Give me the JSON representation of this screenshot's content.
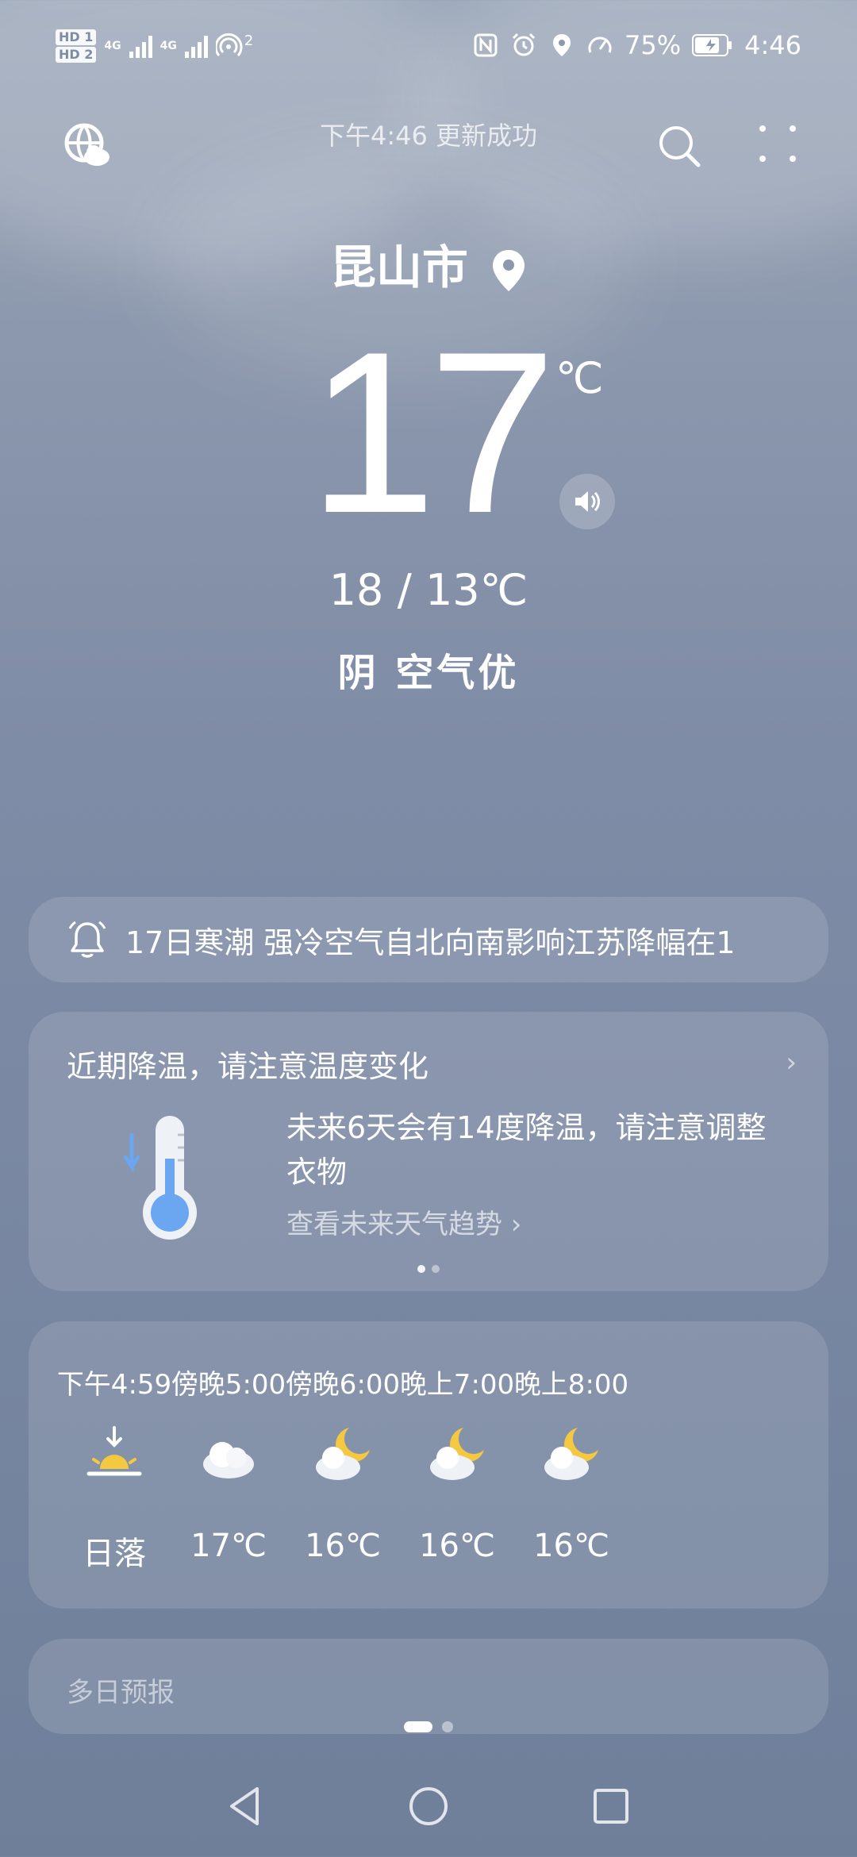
{
  "status_bar": {
    "hd1": "HD 1",
    "hd2": "HD 2",
    "net1": "4G",
    "net2": "4G",
    "hotspot_count": "2",
    "battery": "75%",
    "time": "4:46"
  },
  "header": {
    "update_status": "下午4:46 更新成功"
  },
  "location": {
    "city": "昆山市"
  },
  "current": {
    "temperature": "17",
    "unit": "℃",
    "range": "18 / 13℃",
    "condition": "阴  空气优"
  },
  "alert": {
    "text": "17日寒潮 强冷空气自北向南影响江苏降幅在1"
  },
  "tip_card": {
    "title": "近期降温，请注意温度变化",
    "description": "未来6天会有14度降温，请注意调整衣物",
    "link": "查看未来天气趋势"
  },
  "hourly": [
    {
      "time": "下午4:59",
      "icon": "sunset-icon",
      "value": "日落"
    },
    {
      "time": "傍晚5:00",
      "icon": "cloudy-icon",
      "value": "17℃"
    },
    {
      "time": "傍晚6:00",
      "icon": "cloudy-night-icon",
      "value": "16℃"
    },
    {
      "time": "晚上7:00",
      "icon": "cloudy-night-icon",
      "value": "16℃"
    },
    {
      "time": "晚上8:00",
      "icon": "cloudy-night-icon",
      "value": "16℃"
    }
  ],
  "daily": {
    "label": "多日预报"
  },
  "colors": {
    "accent_sun": "#f5c842",
    "thermo_blue": "#6aa7f0"
  }
}
